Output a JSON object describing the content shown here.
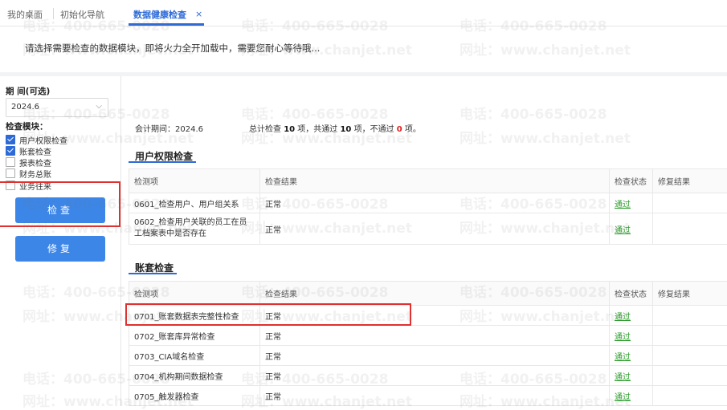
{
  "tabs": [
    {
      "label": "我的桌面"
    },
    {
      "label": "初始化导航"
    },
    {
      "label": "数据健康检查",
      "close": "×"
    }
  ],
  "notice": "请选择需要检查的数据模块，即将火力全开加载中，需要您耐心等待哦...",
  "period": {
    "label": "期 间(可选)",
    "value": "2024.6",
    "arrow": "⌵"
  },
  "modules": {
    "label": "检查模块：",
    "items": [
      {
        "label": "用户权限检查",
        "checked": true
      },
      {
        "label": "账套检查",
        "checked": true
      },
      {
        "label": "报表检查",
        "checked": false
      },
      {
        "label": "财务总账",
        "checked": false
      },
      {
        "label": "业务往来",
        "checked": false
      }
    ]
  },
  "buttons": {
    "check": "检查",
    "repair": "修复"
  },
  "summary": {
    "period_text": "会计期间：2024.6",
    "total_prefix": "总计检查 ",
    "total": "10",
    "total_suffix": " 项，共通过 ",
    "passed": "10",
    "passed_suffix": " 项，不通过 ",
    "failed": "0",
    "failed_suffix": " 项。"
  },
  "columns": {
    "item": "检测项",
    "result": "检查结果",
    "status": "检查状态",
    "repair": "修复结果"
  },
  "sections": [
    {
      "title": "用户权限检查",
      "rows": [
        {
          "item": "0601_检查用户、用户组关系",
          "result": "正常",
          "status": "通过",
          "repair": ""
        },
        {
          "item": "0602_检查用户关联的员工在员工档案表中是否存在",
          "result": "正常",
          "status": "通过",
          "repair": ""
        }
      ]
    },
    {
      "title": "账套检查",
      "rows": [
        {
          "item": "0701_账套数据表完整性检查",
          "result": "正常",
          "status": "通过",
          "repair": ""
        },
        {
          "item": "0702_账套库异常检查",
          "result": "正常",
          "status": "通过",
          "repair": ""
        },
        {
          "item": "0703_CIA域名检查",
          "result": "正常",
          "status": "通过",
          "repair": ""
        },
        {
          "item": "0704_机构期间数据检查",
          "result": "正常",
          "status": "通过",
          "repair": ""
        },
        {
          "item": "0705_触发器检查",
          "result": "正常",
          "status": "通过",
          "repair": ""
        }
      ]
    }
  ],
  "watermark": {
    "phone": "电话：400-665-0028",
    "site": "网址：www.chanjet.net"
  },
  "colors": {
    "accent": "#2d6ad6",
    "button": "#3c86e8",
    "pass": "#2a9d2a",
    "fail": "#e02020",
    "highlight": "#e03030"
  }
}
